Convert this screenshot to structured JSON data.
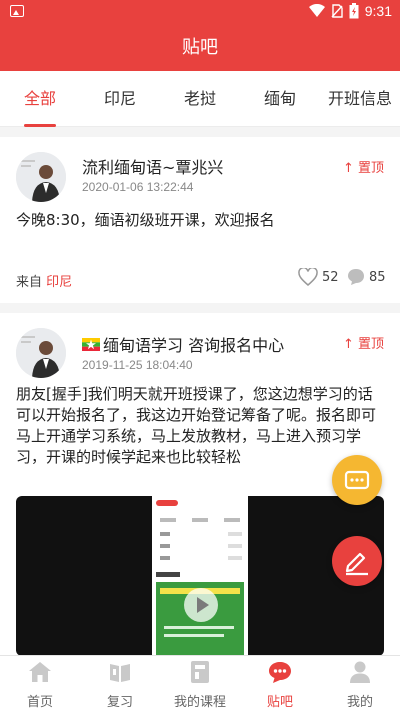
{
  "status_bar": {
    "time": "9:31"
  },
  "header": {
    "title": "贴吧"
  },
  "tabs": [
    {
      "label": "全部",
      "active": true
    },
    {
      "label": "印尼",
      "active": false
    },
    {
      "label": "老挝",
      "active": false
    },
    {
      "label": "缅甸",
      "active": false
    },
    {
      "label": "开班信息",
      "active": false
    }
  ],
  "posts": [
    {
      "author": "流利缅甸语~覃兆兴",
      "date": "2020-01-06 13:22:44",
      "pin_label": "置顶",
      "text": "今晚8:30，缅语初级班开课，欢迎报名",
      "from_prefix": "来自",
      "from_source": "印尼",
      "likes": "52",
      "comments": "85"
    },
    {
      "author": "缅甸语学习 咨询报名中心",
      "date": "2019-11-25 18:04:40",
      "pin_label": "置顶",
      "text": "朋友[握手]我们明天就开班授课了，您这边想学习的话可以开始报名了，我这边开始登记筹备了呢。报名即可马上开通学习系统，马上发放教材，马上进入预习学习，开课的时候学起来也比较轻松"
    }
  ],
  "bottom_nav": [
    {
      "label": "首页",
      "icon": "home-icon",
      "active": false
    },
    {
      "label": "复习",
      "icon": "book-icon",
      "active": false
    },
    {
      "label": "我的课程",
      "icon": "course-icon",
      "active": false
    },
    {
      "label": "贴吧",
      "icon": "forum-icon",
      "active": true
    },
    {
      "label": "我的",
      "icon": "profile-icon",
      "active": false
    }
  ],
  "colors": {
    "accent": "#e8413e",
    "fab_chat": "#f5b731"
  }
}
